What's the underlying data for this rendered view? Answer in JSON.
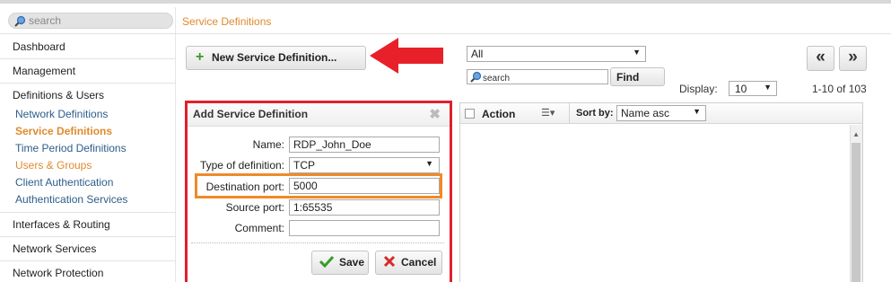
{
  "header": {
    "search_placeholder": "search",
    "page_title": "Service Definitions"
  },
  "sidebar": {
    "items": [
      {
        "label": "Dashboard"
      },
      {
        "label": "Management"
      }
    ],
    "group": {
      "label": "Definitions & Users",
      "children": [
        {
          "label": "Network Definitions"
        },
        {
          "label": "Service Definitions"
        },
        {
          "label": "Time Period Definitions"
        },
        {
          "label": "Users & Groups"
        },
        {
          "label": "Client Authentication"
        },
        {
          "label": "Authentication Services"
        }
      ]
    },
    "items_after": [
      {
        "label": "Interfaces & Routing"
      },
      {
        "label": "Network Services"
      },
      {
        "label": "Network Protection"
      }
    ]
  },
  "toolbar": {
    "new_button_label": "New Service Definition...",
    "filter_value": "All",
    "search_placeholder": "search",
    "find_label": "Find",
    "display_label": "Display:",
    "display_value": "10",
    "paging_text": "1-10 of 103",
    "prev_label": "«",
    "next_label": "»"
  },
  "form": {
    "title": "Add Service Definition",
    "close_label": "✖",
    "fields": {
      "name_label": "Name:",
      "name_value": "RDP_John_Doe",
      "type_label": "Type of definition:",
      "type_value": "TCP",
      "dest_label": "Destination port:",
      "dest_value": "5000",
      "source_label": "Source port:",
      "source_value": "1:65535",
      "comment_label": "Comment:",
      "comment_value": ""
    },
    "save_label": "Save",
    "cancel_label": "Cancel"
  },
  "list": {
    "action_label": "Action",
    "sortby_label": "Sort by:",
    "sort_value": "Name asc"
  },
  "colors": {
    "accent_orange": "#e08a2d",
    "highlight_red": "#e0202a",
    "highlight_orange": "#f08a28",
    "link_blue": "#2d5d8a"
  }
}
